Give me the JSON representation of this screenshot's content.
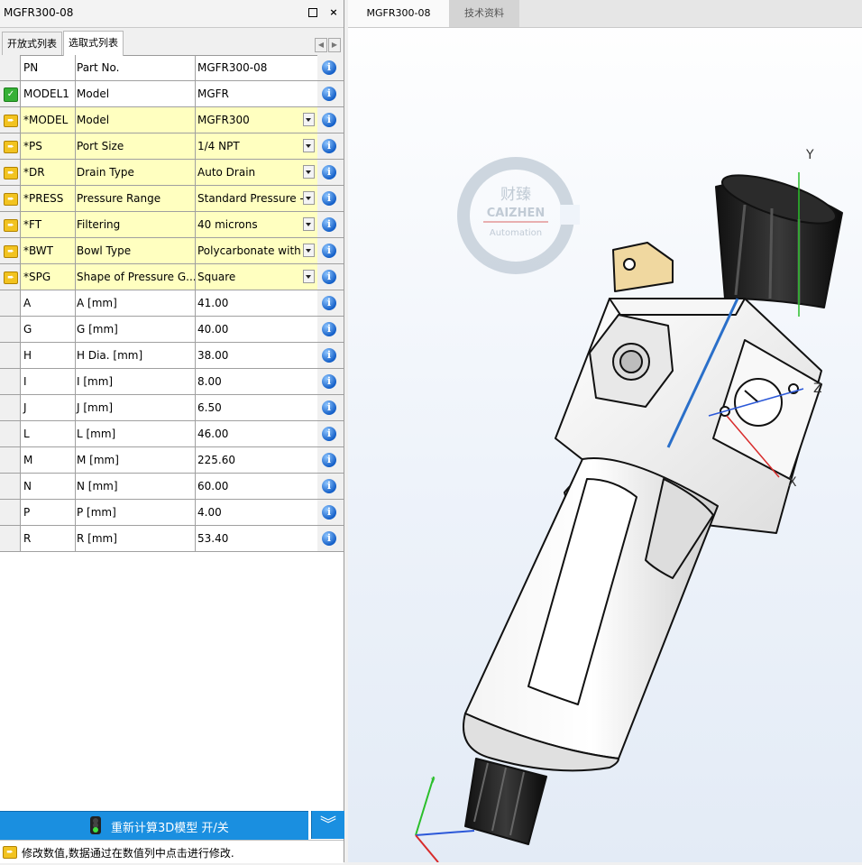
{
  "left_panel": {
    "title": "MGFR300-08",
    "tabs": [
      "开放式列表",
      "选取式列表"
    ],
    "rows": [
      {
        "indicator": "none",
        "pn": "PN",
        "name": "Part No.",
        "value": "MGFR300-08",
        "dropdown": false
      },
      {
        "indicator": "check",
        "pn": "MODEL1",
        "name": "Model",
        "value": "MGFR",
        "dropdown": false
      },
      {
        "indicator": "arrow",
        "pn": "*MODEL",
        "name": "Model",
        "value": "MGFR300",
        "dropdown": true
      },
      {
        "indicator": "arrow",
        "pn": "*PS",
        "name": "Port Size",
        "value": "1/4 NPT",
        "dropdown": true
      },
      {
        "indicator": "arrow",
        "pn": "*DR",
        "name": "Drain Type",
        "value": "Auto Drain",
        "dropdown": true
      },
      {
        "indicator": "arrow",
        "pn": "*PRESS",
        "name": "Pressure Range",
        "value": "Standard Pressure -",
        "dropdown": true
      },
      {
        "indicator": "arrow",
        "pn": "*FT",
        "name": "Filtering",
        "value": "40 microns",
        "dropdown": true
      },
      {
        "indicator": "arrow",
        "pn": "*BWT",
        "name": "Bowl Type",
        "value": "Polycarbonate with",
        "dropdown": true
      },
      {
        "indicator": "arrow",
        "pn": "*SPG",
        "name": "Shape of Pressure G...",
        "value": "Square",
        "dropdown": true
      },
      {
        "indicator": "none",
        "pn": "A",
        "name": "A [mm]",
        "value": "41.00",
        "dropdown": false
      },
      {
        "indicator": "none",
        "pn": "G",
        "name": "G [mm]",
        "value": "40.00",
        "dropdown": false
      },
      {
        "indicator": "none",
        "pn": "H",
        "name": "H Dia. [mm]",
        "value": "38.00",
        "dropdown": false
      },
      {
        "indicator": "none",
        "pn": "I",
        "name": "I [mm]",
        "value": "8.00",
        "dropdown": false
      },
      {
        "indicator": "none",
        "pn": "J",
        "name": "J [mm]",
        "value": "6.50",
        "dropdown": false
      },
      {
        "indicator": "none",
        "pn": "L",
        "name": "L [mm]",
        "value": "46.00",
        "dropdown": false
      },
      {
        "indicator": "none",
        "pn": "M",
        "name": "M [mm]",
        "value": "225.60",
        "dropdown": false
      },
      {
        "indicator": "none",
        "pn": "N",
        "name": "N [mm]",
        "value": "60.00",
        "dropdown": false
      },
      {
        "indicator": "none",
        "pn": "P",
        "name": "P [mm]",
        "value": "4.00",
        "dropdown": false
      },
      {
        "indicator": "none",
        "pn": "R",
        "name": "R [mm]",
        "value": "53.40",
        "dropdown": false
      }
    ],
    "recalc_label": "重新计算3D模型 开/关",
    "status_message": "修改数值,数据通过在数值列中点击进行修改."
  },
  "right_panel": {
    "tabs": [
      "MGFR300-08",
      "技术资料"
    ],
    "watermark": {
      "cn": "财臻",
      "brand": "CAIZHEN",
      "sub": "Automation"
    },
    "axes": {
      "y": "Y",
      "z": "Z",
      "x": "X"
    }
  },
  "colors": {
    "accent": "#1a8fe0",
    "editable_row": "#ffffc0"
  }
}
